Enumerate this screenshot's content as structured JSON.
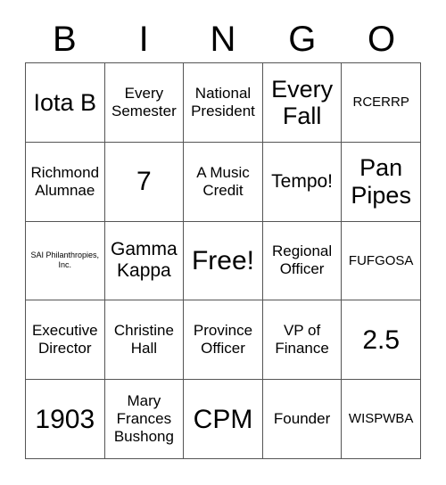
{
  "card": {
    "header_letters": [
      "B",
      "I",
      "N",
      "G",
      "O"
    ],
    "columns": 5,
    "rows": 5,
    "free_space_label": "Free!",
    "free_space_position": {
      "row": 3,
      "column": 3
    },
    "grid_line_color": "#555555",
    "text_color": "#000000",
    "background_color": "#ffffff",
    "cells": [
      [
        {
          "text": "Iota B",
          "size": "lg"
        },
        {
          "text": "Every Semester",
          "size": "sm"
        },
        {
          "text": "National President",
          "size": "sm"
        },
        {
          "text": "Every Fall",
          "size": "lg"
        },
        {
          "text": "RCERRP",
          "size": "xs"
        }
      ],
      [
        {
          "text": "Richmond Alumnae",
          "size": "sm"
        },
        {
          "text": "7",
          "size": "xl"
        },
        {
          "text": "A Music Credit",
          "size": "sm"
        },
        {
          "text": "Tempo!",
          "size": "md"
        },
        {
          "text": "Pan Pipes",
          "size": "lg"
        }
      ],
      [
        {
          "text": "SAI Philanthropies, Inc.",
          "size": "xxs"
        },
        {
          "text": "Gamma Kappa",
          "size": "md"
        },
        {
          "text": "Free!",
          "size": "xl"
        },
        {
          "text": "Regional Officer",
          "size": "sm"
        },
        {
          "text": "FUFGOSA",
          "size": "xs"
        }
      ],
      [
        {
          "text": "Executive Director",
          "size": "sm"
        },
        {
          "text": "Christine Hall",
          "size": "sm"
        },
        {
          "text": "Province Officer",
          "size": "sm"
        },
        {
          "text": "VP of Finance",
          "size": "sm"
        },
        {
          "text": "2.5",
          "size": "xl"
        }
      ],
      [
        {
          "text": "1903",
          "size": "xl"
        },
        {
          "text": "Mary Frances Bushong",
          "size": "sm"
        },
        {
          "text": "CPM",
          "size": "xl"
        },
        {
          "text": "Founder",
          "size": "sm"
        },
        {
          "text": "WISPWBA",
          "size": "xs"
        }
      ]
    ]
  }
}
